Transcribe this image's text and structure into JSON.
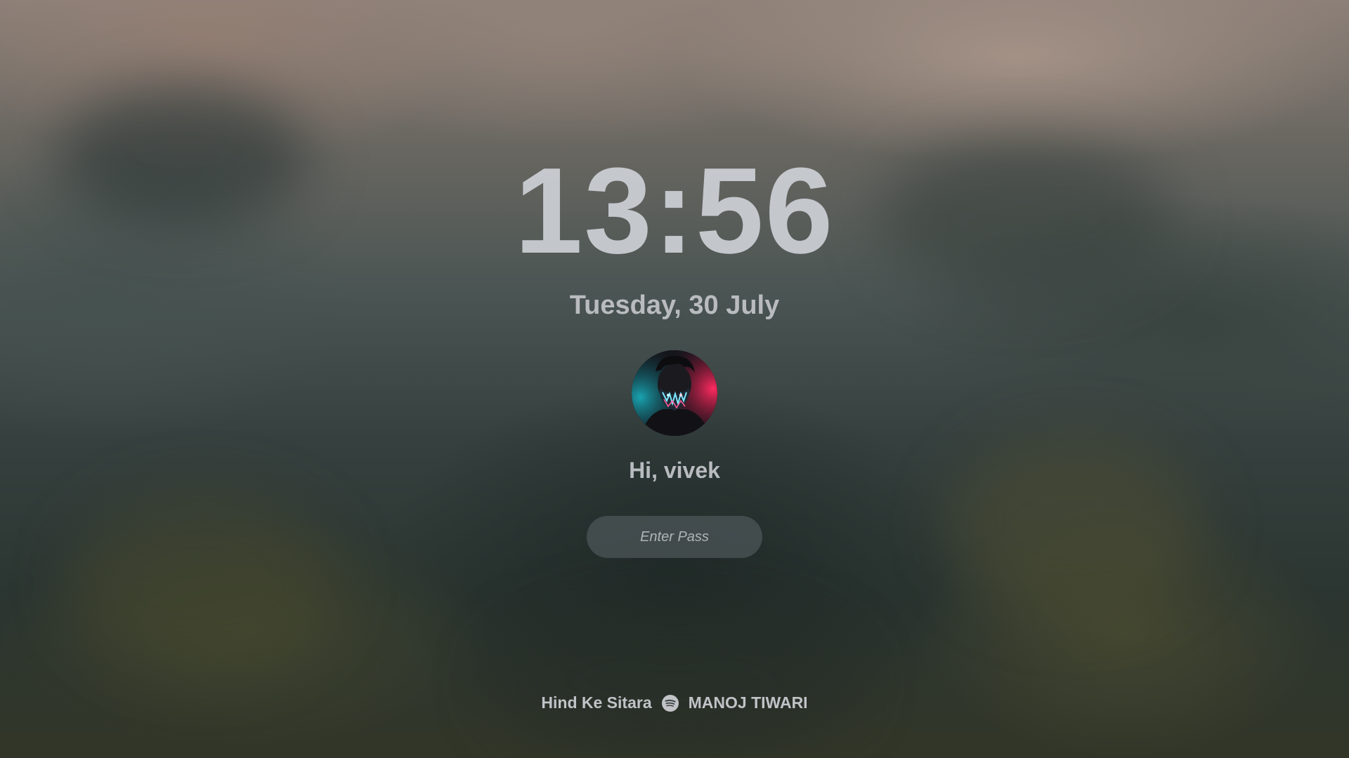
{
  "lockscreen": {
    "time": "13:56",
    "date": "Tuesday, 30 July",
    "greeting": "Hi, vivek",
    "password_placeholder": "Enter Pass"
  },
  "avatar": {
    "icon": "user-avatar"
  },
  "now_playing": {
    "track": "Hind Ke Sitara",
    "artist": "MANOJ TIWARI",
    "icon": "spotify-icon"
  }
}
